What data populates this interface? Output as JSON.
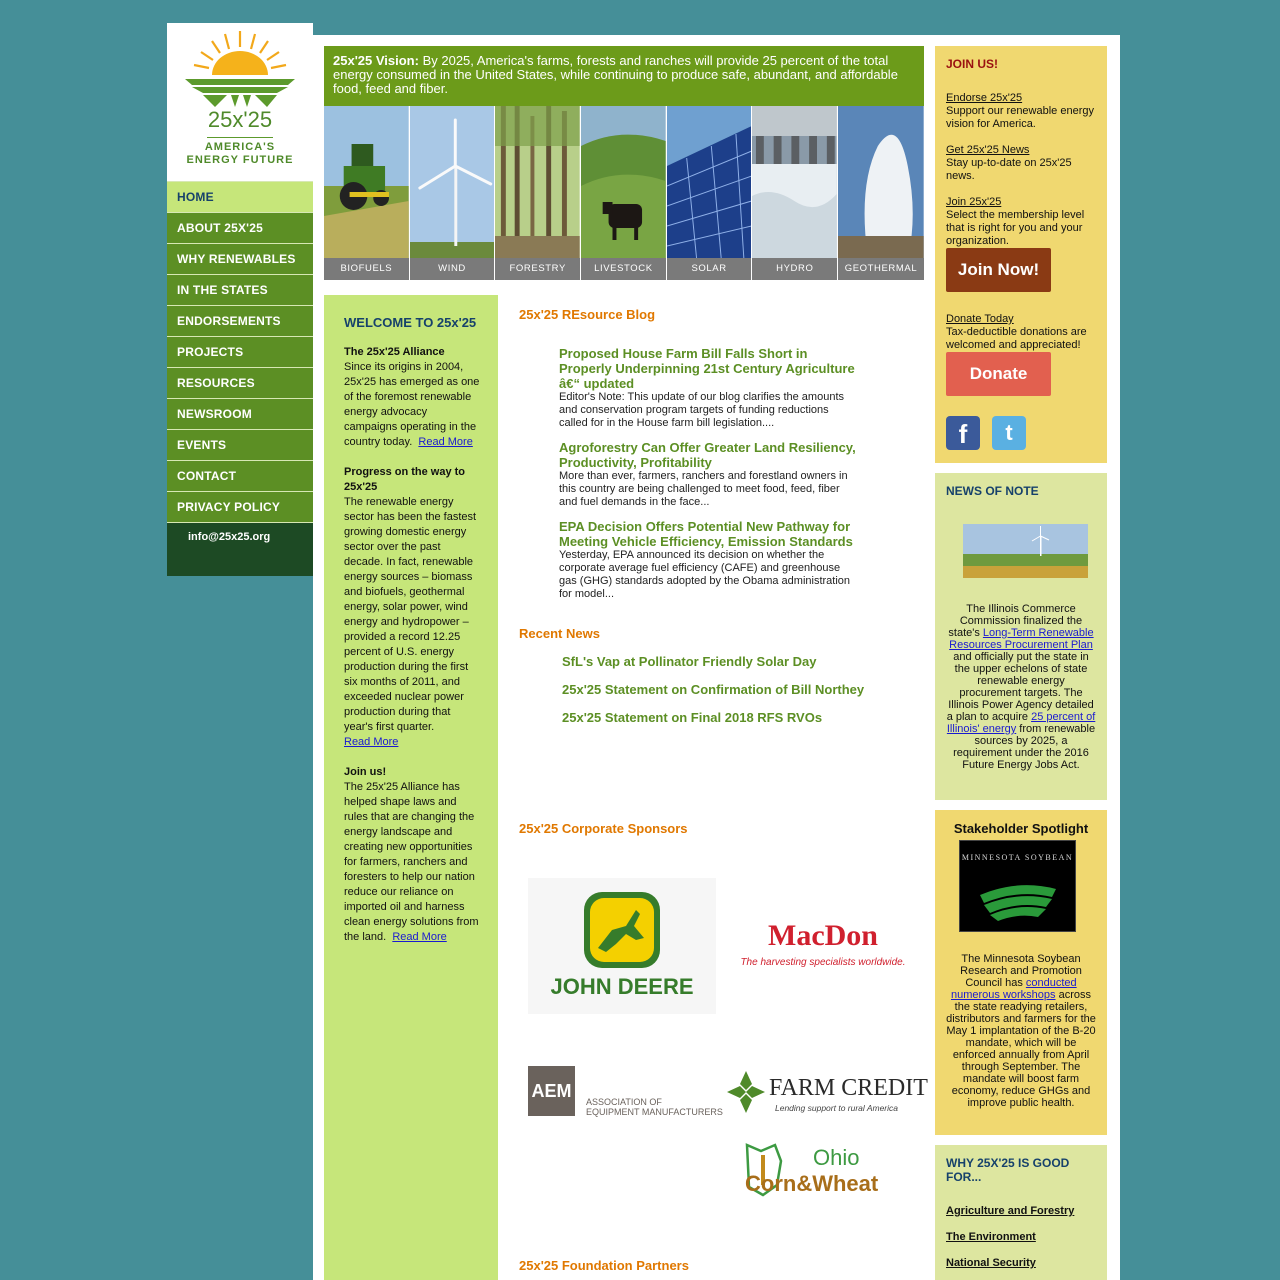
{
  "logo": {
    "number": "25x'25",
    "line1": "AMERICA'S",
    "line2": "ENERGY FUTURE"
  },
  "nav": {
    "items": [
      {
        "label": "HOME"
      },
      {
        "label": "ABOUT 25X'25"
      },
      {
        "label": "WHY RENEWABLES"
      },
      {
        "label": "IN THE STATES"
      },
      {
        "label": "ENDORSEMENTS"
      },
      {
        "label": "PROJECTS"
      },
      {
        "label": "RESOURCES"
      },
      {
        "label": "NEWSROOM"
      },
      {
        "label": "EVENTS"
      },
      {
        "label": "CONTACT"
      },
      {
        "label": "PRIVACY POLICY"
      }
    ],
    "email": "info@25x25.org"
  },
  "vision": {
    "lead": "25x'25 Vision:",
    "text": " By 2025, America's farms, forests and ranches will provide 25 percent of the total energy consumed in the United States, while continuing to produce safe, abundant, and affordable food, feed and fiber."
  },
  "photos": [
    "BIOFUELS",
    "WIND",
    "FORESTRY",
    "LIVESTOCK",
    "SOLAR",
    "HYDRO",
    "GEOTHERMAL"
  ],
  "welcome": {
    "title": "WELCOME TO 25x'25",
    "b1_head": "The 25x'25 Alliance",
    "b1_text": "Since its origins in 2004, 25x'25 has emerged as one of the foremost renewable energy advocacy campaigns operating in the country today.",
    "b1_more": "Read More",
    "b2_head": "Progress on the way to 25x'25",
    "b2_text": "The renewable energy sector has been the fastest growing domestic energy sector over the past decade. In fact, renewable energy sources – biomass and biofuels, geothermal energy, solar power, wind energy and hydropower – provided a record 12.25 percent of U.S. energy production during the first six months of 2011, and exceeded nuclear power production during that year's first quarter.",
    "b2_more": "Read More",
    "b3_head": "Join us!",
    "b3_text": "The 25x'25 Alliance has helped shape laws and rules that are changing the energy landscape and creating new opportunities for farmers, ranchers and foresters to help our  nation reduce our reliance on imported oil and harness clean energy solutions from the land.",
    "b3_more": "Read More"
  },
  "blog": {
    "title": "25x'25 REsource Blog",
    "posts": [
      {
        "title": "Proposed House Farm Bill Falls Short in Properly Underpinning 21st Century Agriculture â€“ updated",
        "text": "Editor's Note: This update of our blog clarifies the amounts and conservation program targets of funding reductions called for in the House farm bill legislation...."
      },
      {
        "title": "Agroforestry Can Offer Greater Land Resiliency, Productivity, Profitability",
        "text": "More than ever, farmers, ranchers and forestland owners in this country are being challenged to meet food, feed, fiber and fuel demands in the face..."
      },
      {
        "title": "EPA Decision Offers Potential New Pathway for Meeting Vehicle Efficiency, Emission Standards",
        "text": "Yesterday, EPA announced its decision on whether the corporate average fuel efficiency (CAFE) and greenhouse gas (GHG) standards adopted by the Obama administration for model..."
      }
    ]
  },
  "news": {
    "title": "Recent News",
    "items": [
      "SfL's Vap at Pollinator Friendly Solar Day",
      "25x'25 Statement on Confirmation of Bill Northey",
      "25x'25 Statement on Final 2018 RFS RVOs"
    ]
  },
  "sponsors": {
    "title": "25x'25 Corporate Sponsors",
    "johndeere": "JOHN DEERE",
    "macdon": "MacDon",
    "macdon_tag": "The harvesting specialists worldwide.",
    "aem": "AEM",
    "aem_line1": "ASSOCIATION OF",
    "aem_line2": "EQUIPMENT MANUFACTURERS",
    "farmcredit": "FARM CREDIT",
    "farmcredit_tag": "Lending support to rural America",
    "ohio1": "Ohio",
    "ohio2": "Corn&Wheat"
  },
  "foundation": {
    "title": "25x'25 Foundation Partners"
  },
  "join": {
    "title": "JOIN US!",
    "endorse_link": "Endorse 25x'25",
    "endorse_text": "Support our renewable energy vision for America.",
    "news_link": "Get 25x'25 News",
    "news_text": "Stay up-to-date on 25x'25 news.",
    "join_link": "Join 25x'25",
    "join_text": "Select the membership level that is right for you and your organization.",
    "join_button": "Join Now!",
    "donate_link": "Donate Today",
    "donate_text": "Tax-deductible donations are welcomed and appreciated!",
    "donate_button": "Donate"
  },
  "note": {
    "title": "NEWS OF NOTE",
    "t1": "The Illinois Commerce Commission finalized the state's ",
    "link1": "Long-Term Renewable Resources Procurement Plan",
    "t2": " and officially put the state in the upper echelons of state renewable energy procurement targets. The Illinois Power Agency detailed a plan to acquire ",
    "link2": "25 percent of Illinois' energy",
    "t3": " from renewable sources by 2025, a requirement under the 2016 Future Energy Jobs Act."
  },
  "spotlight": {
    "title": "Stakeholder Spotlight",
    "logo_text": "MINNESOTA SOYBEAN",
    "t1": "The Minnesota Soybean Research and Promotion Council has ",
    "link": "conducted numerous workshops",
    "t2": " across the state readying retailers, distributors and farmers for the May 1 implantation of the B-20 mandate, which will be enforced annually from April through September. The mandate will boost farm economy, reduce GHGs and improve public health."
  },
  "why": {
    "title": "WHY 25X'25 IS GOOD FOR...",
    "items": [
      "Agriculture and Forestry",
      "The Environment",
      "National Security"
    ]
  },
  "colors": {
    "green": "#5c8f24",
    "lightgreen": "#c6e67a",
    "orange": "#e07800",
    "teal": "#458f98"
  }
}
